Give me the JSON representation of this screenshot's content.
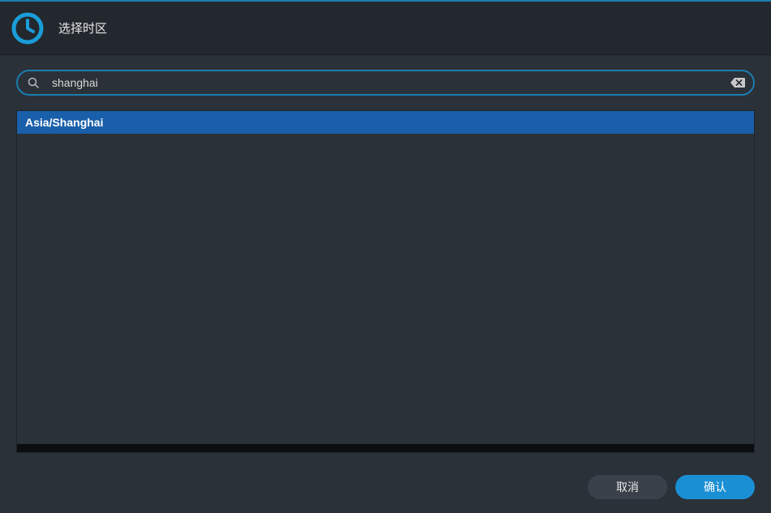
{
  "header": {
    "title": "选择时区"
  },
  "search": {
    "value": "shanghai",
    "placeholder": ""
  },
  "results": [
    {
      "label": "Asia/Shanghai",
      "selected": true
    }
  ],
  "footer": {
    "cancel_label": "取消",
    "confirm_label": "确认"
  },
  "colors": {
    "accent": "#1a7db0",
    "selection": "#195fa9",
    "confirm": "#1a8fd4",
    "bg": "#2b3138"
  }
}
